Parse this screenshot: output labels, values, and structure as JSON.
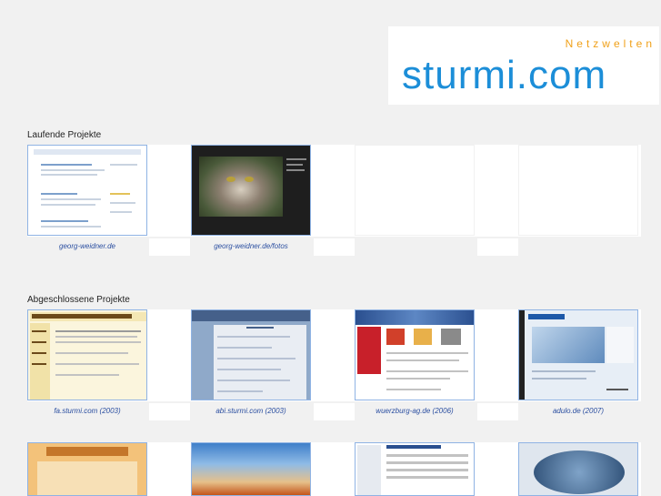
{
  "logo": {
    "tagline": "Netzwelten",
    "name": "sturmi.com",
    "colors": {
      "tagline": "#f0a018",
      "name": "#1c8ed8"
    }
  },
  "sections": {
    "running": {
      "title": "Laufende Projekte",
      "items": [
        {
          "caption": "georg-weidner.de"
        },
        {
          "caption": "georg-weidner.de/fotos"
        }
      ]
    },
    "finished": {
      "title": "Abgeschlossene Projekte",
      "items": [
        {
          "caption": "fa.sturmi.com (2003)"
        },
        {
          "caption": "abi.sturmi.com (2003)"
        },
        {
          "caption": "wuerzburg-ag.de (2006)"
        },
        {
          "caption": "adulo.de (2007)"
        }
      ]
    }
  },
  "colors": {
    "link": "#2a4ea0",
    "thumb_border": "#8fb3e4",
    "page_bg": "#f1f1f1"
  }
}
